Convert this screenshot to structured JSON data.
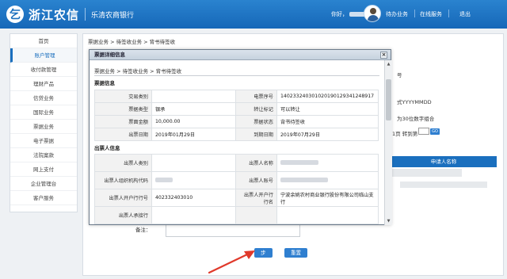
{
  "header": {
    "logo_mark": "乞",
    "bank_name": "浙江农信",
    "branch_name": "乐清农商银行",
    "greeting": "你好，",
    "links": {
      "todo": "待办业务",
      "online_service": "在线服务",
      "logout": "退出"
    }
  },
  "sidebar": {
    "items": [
      {
        "label": "首页"
      },
      {
        "label": "账户管理"
      },
      {
        "label": "收付款管理"
      },
      {
        "label": "理财产品"
      },
      {
        "label": "信贷业务"
      },
      {
        "label": "国际业务"
      },
      {
        "label": "票据业务"
      },
      {
        "label": "电子票据"
      },
      {
        "label": "法院案款"
      },
      {
        "label": "网上支付"
      },
      {
        "label": "企业管理台"
      },
      {
        "label": "客户服务"
      }
    ]
  },
  "main": {
    "breadcrumb": "票据业务 > 待签收业务 > 背书待签收",
    "side_hints": {
      "h1": "号",
      "h2": "式YYYYMMDD",
      "h3": "为30位数字组合",
      "h4": "1页 转到第",
      "go": "GO"
    },
    "table_header": "申请人名称",
    "remark_label": "备注：",
    "submit_label": "步",
    "reset_label": "重置"
  },
  "modal": {
    "title": "票据详细信息",
    "close_symbol": "×",
    "breadcrumb": "票据业务 > 待签收业务 > 背书待签收",
    "bill_section_title": "票据信息",
    "bill_rows": [
      {
        "l1": "交易类别",
        "v1": "",
        "l2": "电票序号",
        "v2": "140233240301020190129341248917"
      },
      {
        "l1": "票据类型",
        "v1": "银承",
        "l2": "转让标记",
        "v2": "可以转让"
      },
      {
        "l1": "票面金额",
        "v1": "10,000.00",
        "l2": "票据状态",
        "v2": "背书待签收"
      },
      {
        "l1": "出票日期",
        "v1": "2019年01月29日",
        "l2": "到期日期",
        "v2": "2019年07月29日"
      }
    ],
    "drawer_section_title": "出票人信息",
    "drawer_rows": [
      {
        "l1": "出票人类别",
        "v1": "",
        "l2": "出票人名称",
        "v2": ""
      },
      {
        "l1": "出票人组织机构代码",
        "v1": "",
        "l2": "出票人账号",
        "v2": ""
      },
      {
        "l1": "出票人开户行行号",
        "v1": "402332403010",
        "l2": "出票人开户行行名",
        "v2": "宁波余姚农村商业银行股份有限公司临山支行"
      },
      {
        "l1": "出票人承接行",
        "v1": "",
        "l2": "",
        "v2": ""
      }
    ]
  },
  "colors": {
    "brand": "#1a6fbe",
    "header": "#2a83cf",
    "arrow": "#e0392b"
  }
}
